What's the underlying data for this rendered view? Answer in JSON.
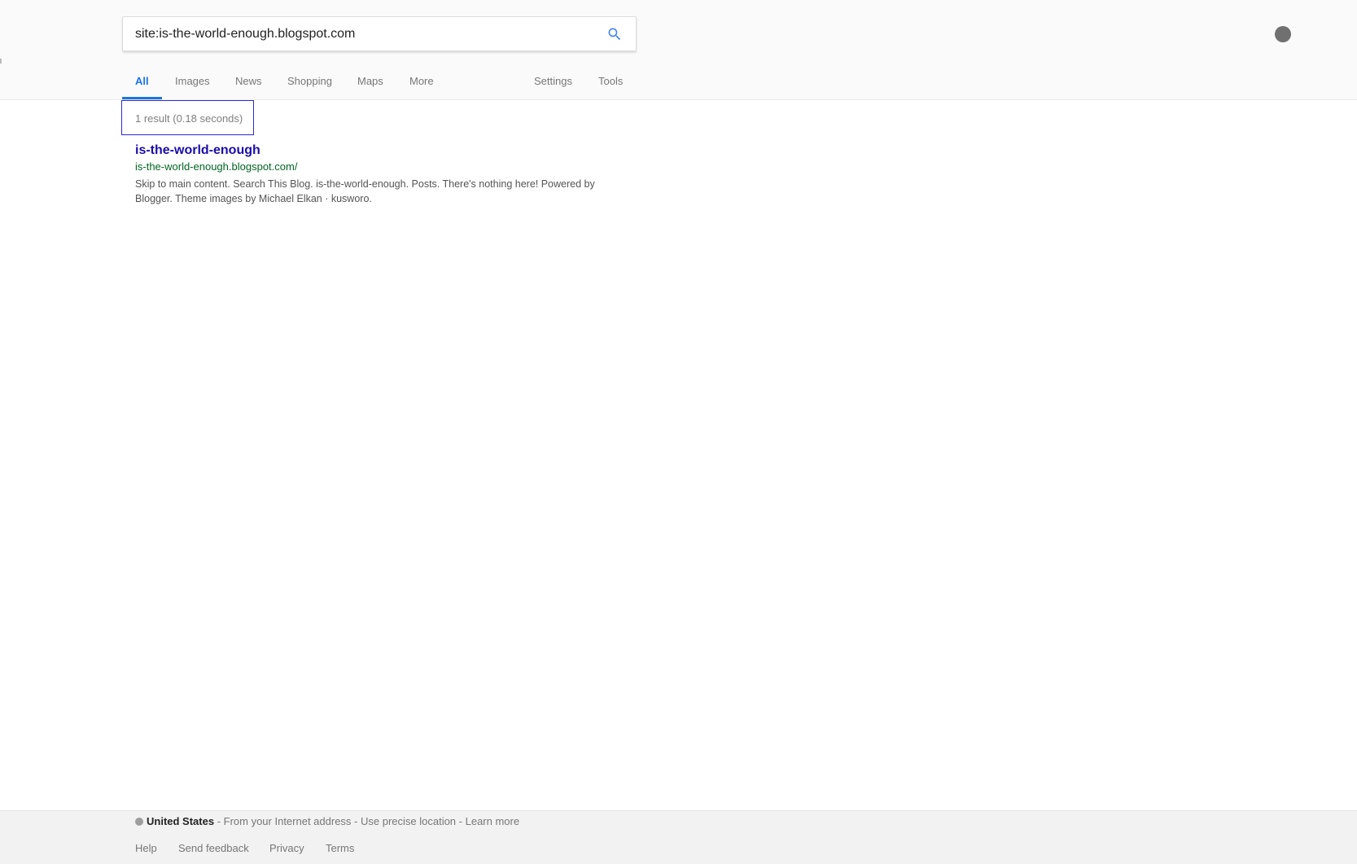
{
  "search": {
    "query": "site:is-the-world-enough.blogspot.com"
  },
  "tabs": [
    {
      "label": "All"
    },
    {
      "label": "Images"
    },
    {
      "label": "News"
    },
    {
      "label": "Shopping"
    },
    {
      "label": "Maps"
    },
    {
      "label": "More"
    },
    {
      "label": "Settings"
    },
    {
      "label": "Tools"
    }
  ],
  "results": {
    "stats": "1 result (0.18 seconds)",
    "items": [
      {
        "title": "is-the-world-enough",
        "url": "is-the-world-enough.blogspot.com/",
        "snippet": "Skip to main content. Search This Blog. is-the-world-enough. Posts. There's nothing here! Powered by Blogger. Theme images by Michael Elkan · kusworo."
      }
    ]
  },
  "footer": {
    "country": "United States",
    "location_source": " - From your Internet address - ",
    "precise_location": "Use precise location",
    "separator": " - ",
    "learn_more": "Learn more",
    "links": [
      {
        "label": "Help"
      },
      {
        "label": "Send feedback"
      },
      {
        "label": "Privacy"
      },
      {
        "label": "Terms"
      }
    ]
  },
  "colors": {
    "accent": "#1a73e8",
    "title_link": "#1a0dab",
    "url_green": "#006621"
  },
  "icons": {
    "search": "search-icon",
    "avatar": "account-avatar"
  }
}
